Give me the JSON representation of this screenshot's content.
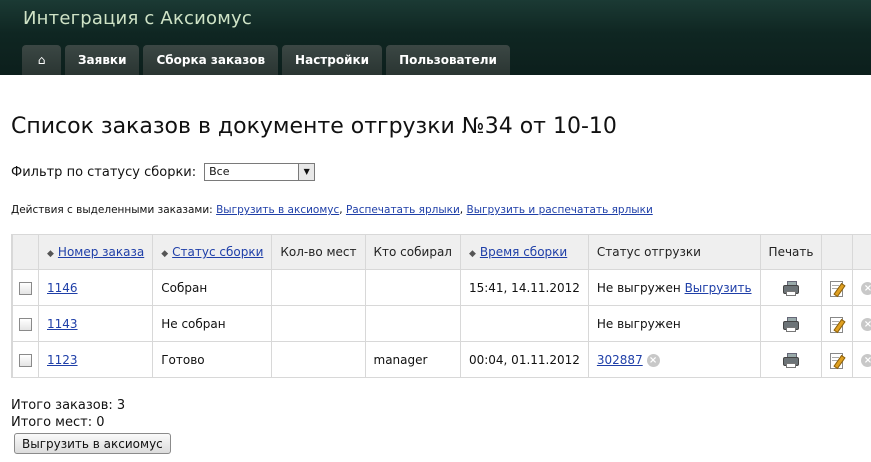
{
  "header": {
    "title": "Интеграция с Аксиомус"
  },
  "nav": {
    "home_icon": "⌂",
    "tabs": [
      {
        "label": "Заявки"
      },
      {
        "label": "Сборка заказов"
      },
      {
        "label": "Настройки"
      },
      {
        "label": "Пользователи"
      }
    ]
  },
  "page": {
    "title": "Список заказов в документе отгрузки №34 от 10-10"
  },
  "filter": {
    "label": "Фильтр по статусу сборки:",
    "selected": "Все"
  },
  "actions": {
    "label": "Действия с выделенными заказами:",
    "links": [
      "Выгрузить в аксиомус",
      "Распечатать ярлыки",
      "Выгрузить и распечатать ярлыки"
    ],
    "separator": ","
  },
  "table": {
    "headers": {
      "order_number": "Номер заказа",
      "build_status": "Статус сборки",
      "places": "Кол-во мест",
      "collector": "Кто собирал",
      "build_time": "Время сборки",
      "ship_status": "Статус отгрузки",
      "print": "Печать"
    },
    "rows": [
      {
        "status_color": "#ff0000",
        "order": "1146",
        "build_status": "Собран",
        "places": "",
        "collector": "",
        "build_time": "15:41, 14.11.2012",
        "ship_status": "Не выгружен",
        "ship_action": "Выгрузить",
        "ship_link": ""
      },
      {
        "status_color": "#ff0000",
        "order": "1143",
        "build_status": "Не собран",
        "places": "",
        "collector": "",
        "build_time": "",
        "ship_status": "Не выгружен",
        "ship_action": "",
        "ship_link": ""
      },
      {
        "status_color": "#008000",
        "order": "1123",
        "build_status": "Готово",
        "places": "",
        "collector": "manager",
        "build_time": "00:04, 01.11.2012",
        "ship_status": "",
        "ship_action": "",
        "ship_link": "302887"
      }
    ]
  },
  "totals": {
    "orders": "Итого заказов: 3",
    "places": "Итого мест: 0"
  },
  "submit_button": "Выгрузить в аксиомус",
  "icons": {
    "sort": "sort-arrows-icon",
    "print": "printer-icon",
    "edit": "edit-icon",
    "delete": "delete-icon"
  }
}
